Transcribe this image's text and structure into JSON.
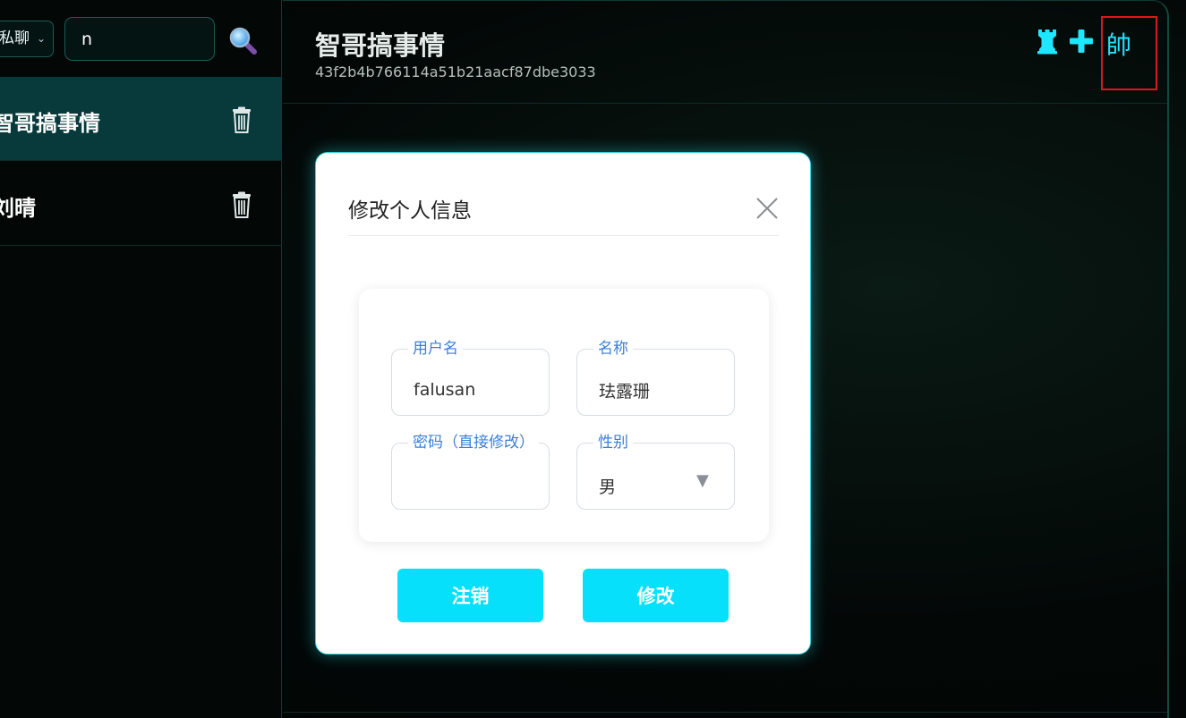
{
  "sidebar": {
    "mode_select": {
      "value": "私聊"
    },
    "search": {
      "value": "n"
    },
    "chats": [
      {
        "name": "智哥搞事情",
        "active": true
      },
      {
        "name": "刘晴",
        "active": false
      }
    ]
  },
  "header": {
    "title": "智哥搞事情",
    "subtitle": "43f2b4b766114a51b21aacf87dbe3033",
    "profile_glyph": "帥"
  },
  "modal": {
    "title": "修改个人信息",
    "fields": {
      "username": {
        "label": "用户名",
        "value": "falusan"
      },
      "nickname": {
        "label": "名称",
        "value": "珐露珊"
      },
      "password": {
        "label": "密码（直接修改）",
        "value": ""
      },
      "gender": {
        "label": "性别",
        "value": "男"
      }
    },
    "buttons": {
      "logout": "注销",
      "submit": "修改"
    }
  },
  "colors": {
    "accent": "#06e0fb",
    "sidebar_active": "#093a3b",
    "highlight_box": "#e0161e",
    "label_blue": "#3b7fd6"
  },
  "icons": {
    "search": "magnifier-icon",
    "delete": "trash-icon",
    "close": "close-icon",
    "rook": "rook-icon",
    "add": "plus-icon",
    "dropdown": "triangle-down-icon"
  }
}
